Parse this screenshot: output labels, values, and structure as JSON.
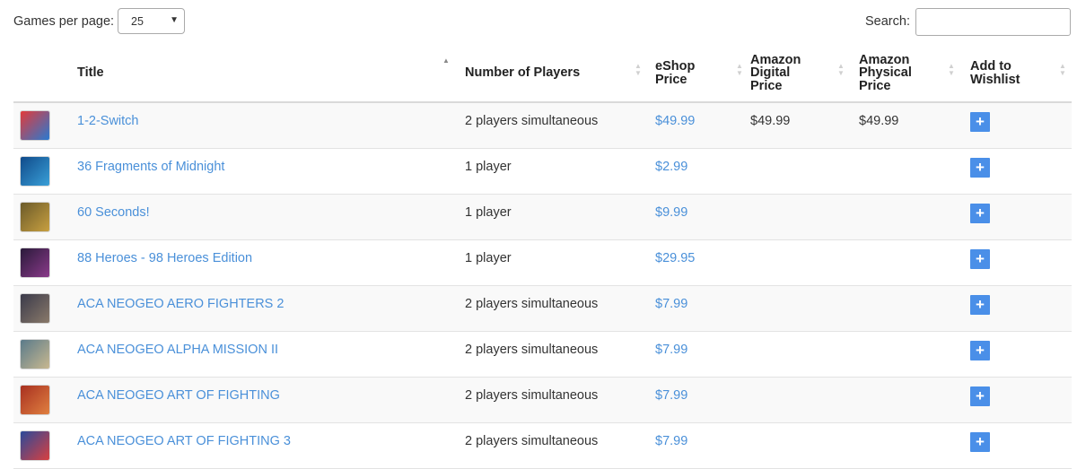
{
  "controls": {
    "per_page_label": "Games per page:",
    "per_page_value": "25",
    "search_label": "Search:",
    "search_value": ""
  },
  "table": {
    "headers": {
      "title": "Title",
      "players": "Number of Players",
      "eshop": [
        "eShop",
        "Price"
      ],
      "amazon_digital": [
        "Amazon",
        "Digital",
        "Price"
      ],
      "amazon_physical": [
        "Amazon",
        "Physical",
        "Price"
      ],
      "wishlist": [
        "Add to",
        "Wishlist"
      ]
    },
    "rows": [
      {
        "title": "1-2-Switch",
        "players": "2 players simultaneous",
        "eshop": "$49.99",
        "amazon_digital": "$49.99",
        "amazon_physical": "$49.99",
        "thumb": [
          "#e23a3a",
          "#2a7ad0"
        ]
      },
      {
        "title": "36 Fragments of Midnight",
        "players": "1 player",
        "eshop": "$2.99",
        "amazon_digital": "",
        "amazon_physical": "",
        "thumb": [
          "#0f4a8a",
          "#3aa0d8"
        ]
      },
      {
        "title": "60 Seconds!",
        "players": "1 player",
        "eshop": "$9.99",
        "amazon_digital": "",
        "amazon_physical": "",
        "thumb": [
          "#6b5a2a",
          "#c8a040"
        ]
      },
      {
        "title": "88 Heroes - 98 Heroes Edition",
        "players": "1 player",
        "eshop": "$29.95",
        "amazon_digital": "",
        "amazon_physical": "",
        "thumb": [
          "#2a1a3a",
          "#8a3a8a"
        ]
      },
      {
        "title": "ACA NEOGEO AERO FIGHTERS 2",
        "players": "2 players simultaneous",
        "eshop": "$7.99",
        "amazon_digital": "",
        "amazon_physical": "",
        "thumb": [
          "#3a3a4a",
          "#8a7a6a"
        ]
      },
      {
        "title": "ACA NEOGEO ALPHA MISSION II",
        "players": "2 players simultaneous",
        "eshop": "$7.99",
        "amazon_digital": "",
        "amazon_physical": "",
        "thumb": [
          "#5a7a8a",
          "#c8b890"
        ]
      },
      {
        "title": "ACA NEOGEO ART OF FIGHTING",
        "players": "2 players simultaneous",
        "eshop": "$7.99",
        "amazon_digital": "",
        "amazon_physical": "",
        "thumb": [
          "#a83020",
          "#e08040"
        ]
      },
      {
        "title": "ACA NEOGEO ART OF FIGHTING 3",
        "players": "2 players simultaneous",
        "eshop": "$7.99",
        "amazon_digital": "",
        "amazon_physical": "",
        "thumb": [
          "#2a4a9a",
          "#d84040"
        ]
      }
    ]
  },
  "colors": {
    "link": "#4a90d9",
    "wishlist_button": "#4a8fe8",
    "row_stripe": "#f9f9f9"
  },
  "icons": {
    "wishlist_button": "plus-icon",
    "sort": "sort-caret-icon"
  }
}
